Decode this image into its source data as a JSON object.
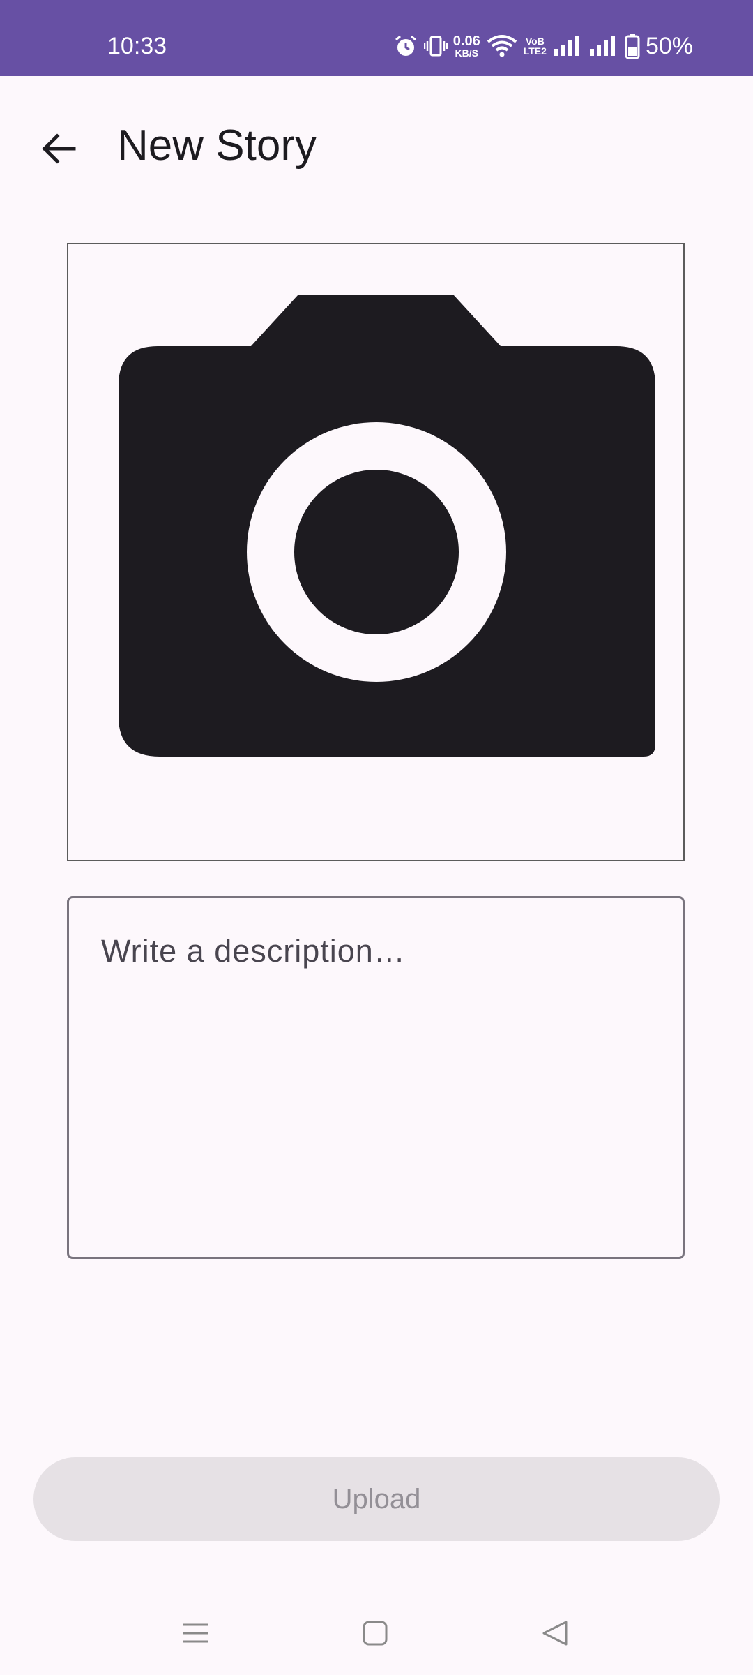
{
  "status_bar": {
    "time": "10:33",
    "net_speed_value": "0.06",
    "net_speed_unit": "KB/S",
    "volte_label_top": "VoB",
    "volte_label_bottom": "LTE2",
    "battery": "50%",
    "icons": [
      "alarm-icon",
      "vibrate-icon",
      "wifi-icon",
      "volte-icon",
      "signal-icon",
      "signal-icon",
      "battery-icon"
    ]
  },
  "app_bar": {
    "title": "New Story",
    "back_icon": "arrow-back-icon"
  },
  "image_picker": {
    "icon": "camera-icon"
  },
  "description": {
    "placeholder": "Write a description…",
    "value": ""
  },
  "actions": {
    "upload_label": "Upload",
    "upload_enabled": false
  },
  "nav_bar": {
    "items": [
      "menu-icon",
      "home-icon",
      "back-triangle-icon"
    ]
  },
  "colors": {
    "status_bar": "#6750a4",
    "background": "#fdf8fc",
    "camera": "#1d1b20",
    "button_disabled_bg": "#e6e1e5",
    "button_disabled_text": "#938f96"
  }
}
